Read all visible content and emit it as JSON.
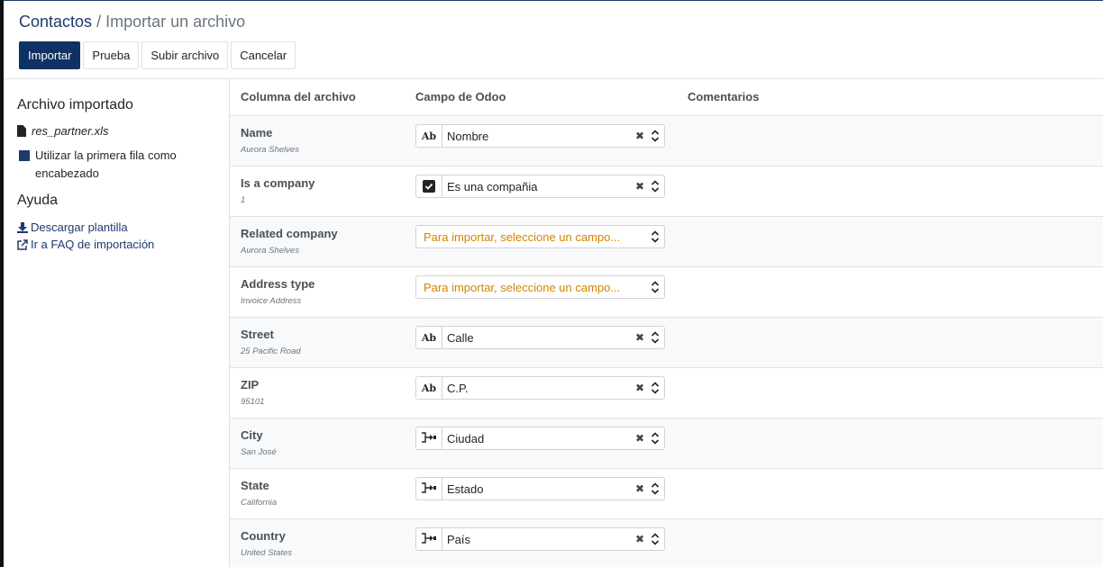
{
  "breadcrumb": {
    "parent": "Contactos",
    "separator": "/",
    "current": "Importar un archivo"
  },
  "buttons": {
    "import": "Importar",
    "test": "Prueba",
    "upload": "Subir archivo",
    "cancel": "Cancelar"
  },
  "sidebar": {
    "imported_title": "Archivo importado",
    "file_name": "res_partner.xls",
    "first_row_option": "Utilizar la primera fila como encabezado",
    "help_title": "Ayuda",
    "download_template": "Descargar plantilla",
    "faq_link": "Ir a FAQ de importación"
  },
  "table": {
    "headers": {
      "file_column": "Columna del archivo",
      "odoo_field": "Campo de Odoo",
      "comments": "Comentarios"
    },
    "rows": [
      {
        "name": "Name",
        "sample": "Aurora Shelves",
        "field": "Nombre",
        "type_icon": "text-icon",
        "placeholder": ""
      },
      {
        "name": "Is a company",
        "sample": "1",
        "field": "Es una compañia",
        "type_icon": "checkbox-icon",
        "placeholder": ""
      },
      {
        "name": "Related company",
        "sample": "Aurora Shelves",
        "field": "",
        "type_icon": "",
        "placeholder": "Para importar, seleccione un campo..."
      },
      {
        "name": "Address type",
        "sample": "Invoice Address",
        "field": "",
        "type_icon": "",
        "placeholder": "Para importar, seleccione un campo..."
      },
      {
        "name": "Street",
        "sample": "25 Pacific Road",
        "field": "Calle",
        "type_icon": "text-icon",
        "placeholder": ""
      },
      {
        "name": "ZIP",
        "sample": "95101",
        "field": "C.P.",
        "type_icon": "text-icon",
        "placeholder": ""
      },
      {
        "name": "City",
        "sample": "San José",
        "field": "Ciudad",
        "type_icon": "relation-icon",
        "placeholder": ""
      },
      {
        "name": "State",
        "sample": "California",
        "field": "Estado",
        "type_icon": "relation-icon",
        "placeholder": ""
      },
      {
        "name": "Country",
        "sample": "United States",
        "field": "País",
        "type_icon": "relation-icon",
        "placeholder": ""
      }
    ]
  },
  "icons": {
    "text": "Ab"
  },
  "colors": {
    "primary": "#0f3165",
    "link": "#1f3a6e",
    "placeholder": "#d68300"
  }
}
